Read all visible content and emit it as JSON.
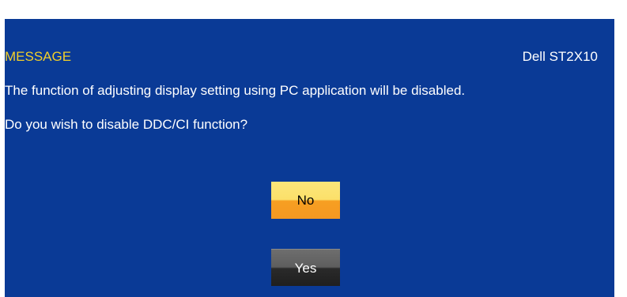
{
  "dialog": {
    "title": "MESSAGE",
    "model": "Dell ST2X10",
    "message_line1": "The function of adjusting display setting using PC application will be disabled.",
    "message_line2": "Do you wish to disable DDC/CI function?"
  },
  "buttons": {
    "no_label": "No",
    "yes_label": "Yes"
  },
  "colors": {
    "background": "#0a3a96",
    "title_accent": "#f2cf2a",
    "selected_button": "#f49822",
    "unselected_button": "#2a2a2a"
  }
}
